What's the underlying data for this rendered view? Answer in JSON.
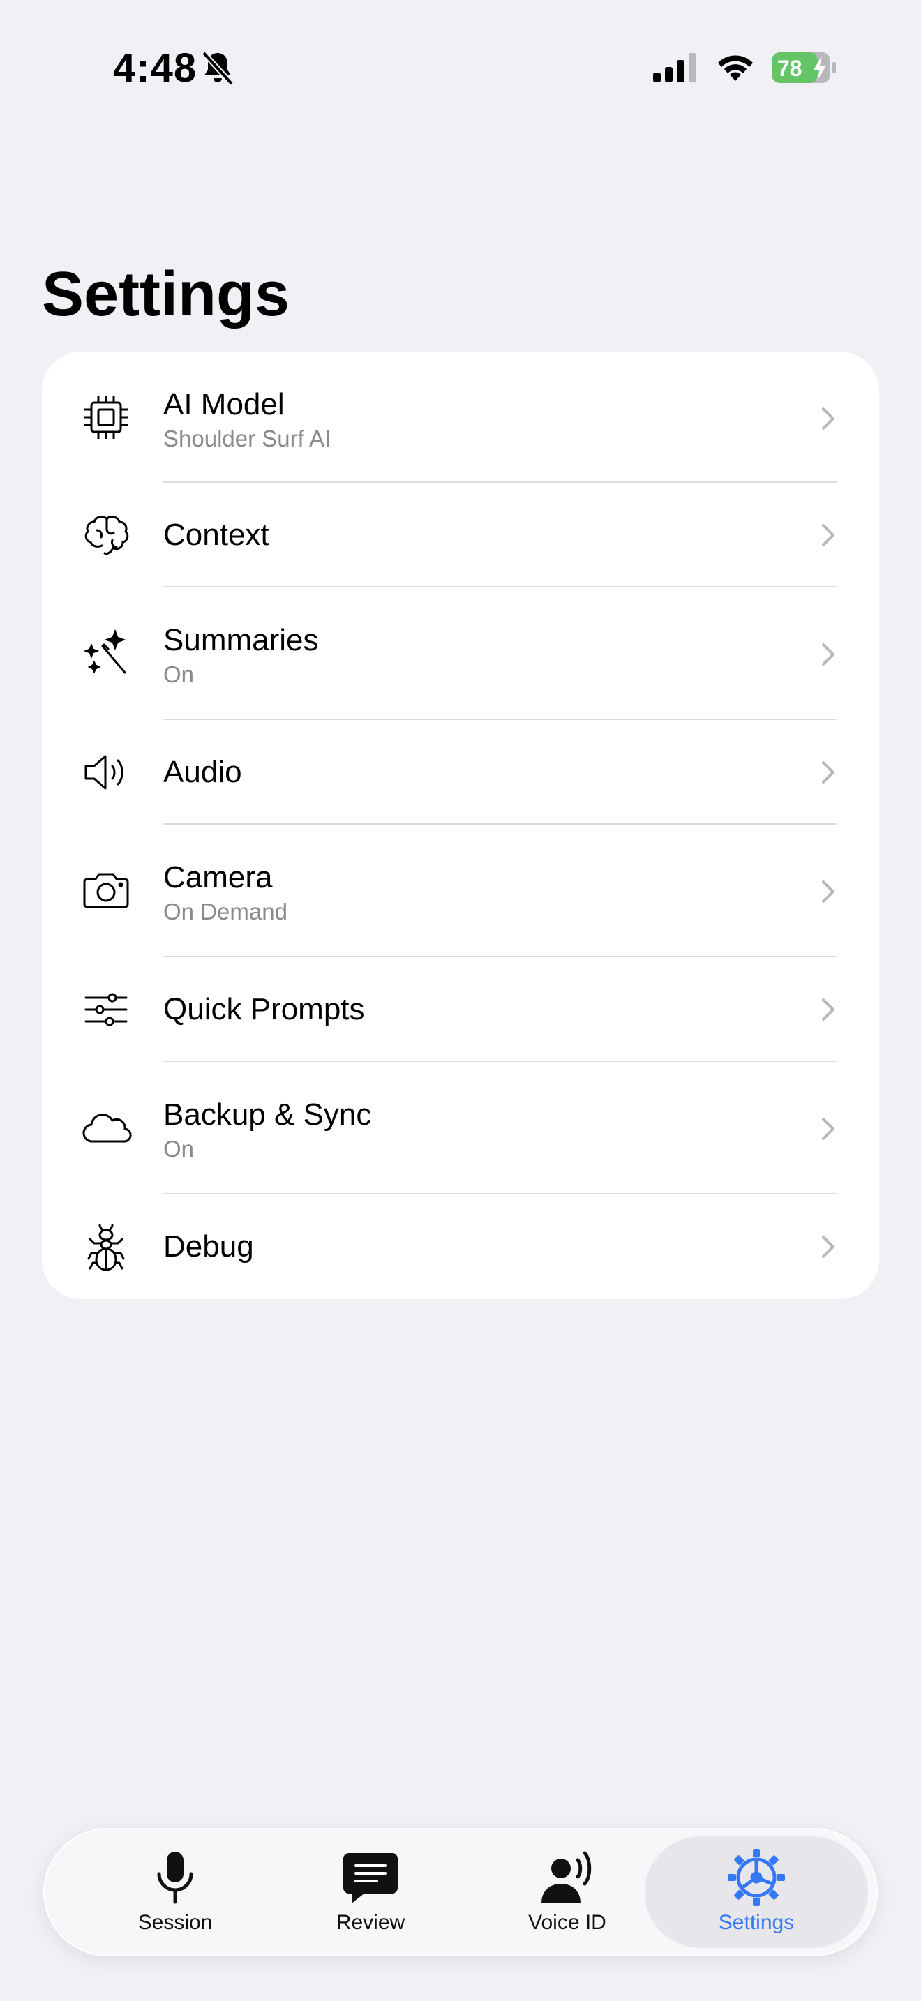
{
  "status_bar": {
    "time": "4:48",
    "battery_percent": "78",
    "battery_color": "#65c466"
  },
  "page": {
    "title": "Settings"
  },
  "settings": [
    {
      "id": "ai-model",
      "label": "AI Model",
      "subtitle": "Shoulder Surf AI",
      "icon": "cpu-chip-icon"
    },
    {
      "id": "context",
      "label": "Context",
      "subtitle": "",
      "icon": "brain-icon"
    },
    {
      "id": "summaries",
      "label": "Summaries",
      "subtitle": "On",
      "icon": "magic-wand-icon"
    },
    {
      "id": "audio",
      "label": "Audio",
      "subtitle": "",
      "icon": "speaker-icon"
    },
    {
      "id": "camera",
      "label": "Camera",
      "subtitle": "On Demand",
      "icon": "camera-icon"
    },
    {
      "id": "quick-prompts",
      "label": "Quick Prompts",
      "subtitle": "",
      "icon": "sliders-icon"
    },
    {
      "id": "backup-sync",
      "label": "Backup & Sync",
      "subtitle": "On",
      "icon": "cloud-icon"
    },
    {
      "id": "debug",
      "label": "Debug",
      "subtitle": "",
      "icon": "ant-icon"
    }
  ],
  "tabs": [
    {
      "label": "Session",
      "icon": "microphone-icon",
      "active": false
    },
    {
      "label": "Review",
      "icon": "chat-bubble-icon",
      "active": false
    },
    {
      "label": "Voice ID",
      "icon": "person-wave-icon",
      "active": false
    },
    {
      "label": "Settings",
      "icon": "gear-icon",
      "active": true
    }
  ],
  "colors": {
    "accent": "#3478f6",
    "background": "#f0f0f5",
    "card": "#ffffff",
    "secondary_text": "#8a8a8e"
  }
}
